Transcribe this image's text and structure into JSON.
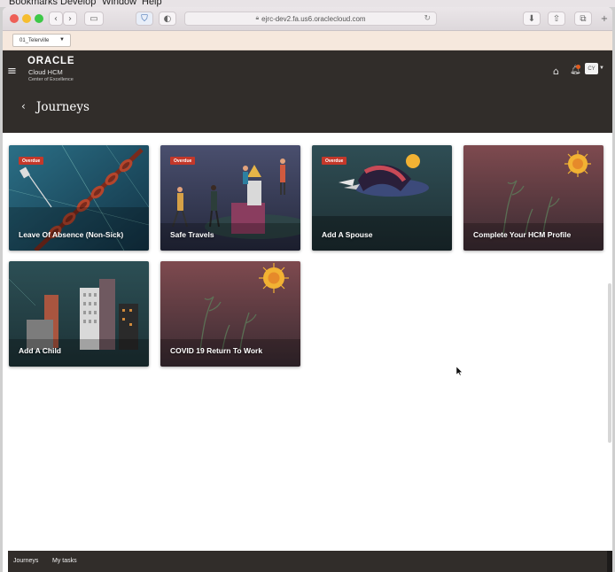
{
  "mac_menu": [
    "Bookmarks",
    "Develop",
    "Window",
    "Help"
  ],
  "browser": {
    "url": "ejrc-dev2.fa.us6.oraclecloud.com",
    "lock_icon": "lock-icon",
    "reload_icon": "reload-icon"
  },
  "favbar": {
    "environment": "01_Telerville"
  },
  "app": {
    "brand": "ORACLE",
    "product": "Cloud HCM",
    "subtitle": "Center of Excellence",
    "avatar": "CY",
    "page_title": "Journeys"
  },
  "cards": [
    {
      "title": "Leave Of Absence (Non-Sick)",
      "badge": "Overdue",
      "art": "chain"
    },
    {
      "title": "Safe Travels",
      "badge": "Overdue",
      "art": "people"
    },
    {
      "title": "Add A Spouse",
      "badge": "Overdue",
      "art": "couple"
    },
    {
      "title": "Complete Your HCM Profile",
      "badge": "",
      "art": "sun"
    },
    {
      "title": "Add A Child",
      "badge": "",
      "art": "city"
    },
    {
      "title": "COVID 19 Return To Work",
      "badge": "",
      "art": "sun"
    }
  ],
  "footer": {
    "links": [
      "Journeys",
      "My tasks"
    ]
  },
  "colors": {
    "header": "#312d2a",
    "overdue": "#c4382a",
    "accent_sun": "#f2b233"
  }
}
